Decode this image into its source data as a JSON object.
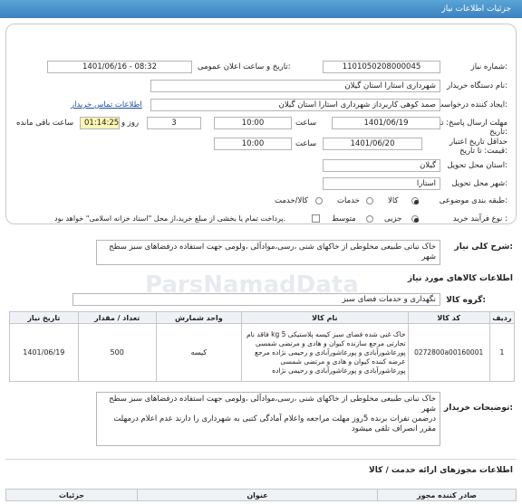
{
  "header": {
    "title": "جزئیات اطلاعات نیاز"
  },
  "fields": {
    "need_number_label": "شماره نیاز:",
    "need_number": "1101050208000045",
    "announce_label": "تاریخ و ساعت اعلان عمومی:",
    "announce_value": "1401/06/16 - 08:32",
    "buyer_org_label": "نام دستگاه خریدار:",
    "buyer_org": "شهرداری استارا استان گیلان",
    "requester_label": "ایجاد کننده درخواست:",
    "requester": "صمد کوهی کاربرداز شهرداری استارا استان گیلان",
    "buyer_contact_link": "اطلاعات تماس خریدار",
    "deadline_label": "مهلت ارسال پاسخ: تا تاریخ:",
    "deadline_date": "1401/06/19",
    "time_label": "ساعت",
    "deadline_time": "10:00",
    "days_count": "3",
    "days_label": "روز و",
    "remaining_time": "01:14:25",
    "remaining_label": "ساعت باقی مانده",
    "validity_label": "حداقل تاریخ اعتبار قیمت: تا تاریخ:",
    "validity_date": "1401/06/20",
    "validity_time": "10:00",
    "province_label": "استان محل تحویل:",
    "province": "گیلان",
    "city_label": "شهر محل تحویل:",
    "city": "استارا",
    "category_label": "طبقه بندی موضوعی:",
    "category_options": [
      "کالا",
      "خدمات",
      "کالا/خدمت"
    ],
    "process_label": "نوع فرآیند خرید :",
    "process_options": [
      "جزیی",
      "متوسط"
    ],
    "payment_note": "پرداخت تمام یا بخشی از مبلغ خرید،از محل \"اسناد خزانه اسلامی\" خواهد بود."
  },
  "summary": {
    "label": "شرح کلی نیاز:",
    "text": "خاک نباتی طبیعی مخلوطی از خاکهای شنی ،رسی،موادآلی ،ولومی جهت استفاده درفضاهای سبز سطح شهر"
  },
  "goods": {
    "section_title": "اطلاعات کالاهای مورد نیاز",
    "group_label": "گروه کالا:",
    "group_value": "نگهداری و خدمات فضای سبز",
    "columns": [
      "ردیف",
      "کد کالا",
      "نام کالا",
      "واحد شمارش",
      "تعداد / مقدار",
      "تاریخ نیاز"
    ],
    "row": {
      "index": "1",
      "code": "0272800a00160001",
      "name": "خاک غنی شده فضای سبز کیسه پلاستیکی 5 kg فاقد نام تجارتی مرجع سازنده کیوان و هادی و مرتضی شمسی پورعاشورآبادی و پورعاشورآبادی و رحیمی نژاده مرجع عرضه کننده کیوان و هادی و مرتضی شمسی پورعاشورآبادی و پورعاشورآبادی و رحیمی نژاده",
      "unit": "کیسه",
      "quantity": "500",
      "need_date": "1401/06/19"
    }
  },
  "buyer_notes": {
    "label": "توضیحات خریدار:",
    "line1": "خاک نباتی طبیعی مخلوطی از خاکهای شنی ،رسی،موادآلی ،ولومی جهت استفاده درفضاهای سبز سطح شهر",
    "line2": "درضمن نفرات برنده 5روز مهلت مراجعه واعلام آمادگی کتبی به شهرداری را دارند عدم اعلام درمهلت مقرر انصراف تلقی میشود"
  },
  "permits": {
    "section_title": "اطلاعات مجوزهای ارائه خدمت / کالا",
    "columns": [
      "جزئیات",
      "عنوان",
      "صادر کننده مجوز"
    ]
  },
  "watermark": {
    "text": "ParsNamadData"
  }
}
